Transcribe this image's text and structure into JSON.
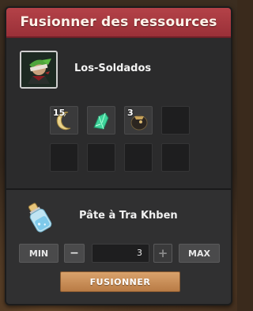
{
  "window": {
    "title": "Fusionner des ressources",
    "colors": {
      "titlebar": "#b44248",
      "panel": "#2a2a2b",
      "accent_button": "#c98c54"
    }
  },
  "player": {
    "name": "Los-Soldados",
    "portrait_icon": "character-portrait-icon"
  },
  "inventory_slots": [
    {
      "quantity": "15",
      "icon": "crescent-moon-resource-icon"
    },
    {
      "quantity": "",
      "icon": "green-crystal-resource-icon"
    },
    {
      "quantity": "3",
      "icon": "dark-pouch-resource-icon"
    },
    {
      "quantity": "",
      "icon": ""
    },
    {
      "quantity": "",
      "icon": ""
    },
    {
      "quantity": "",
      "icon": ""
    },
    {
      "quantity": "",
      "icon": ""
    },
    {
      "quantity": "",
      "icon": ""
    }
  ],
  "result": {
    "name": "Pâte à Tra Khben",
    "icon": "potion-bottle-icon"
  },
  "controls": {
    "min_label": "MIN",
    "minus_label": "−",
    "quantity_value": "3",
    "plus_label": "+",
    "max_label": "MAX",
    "fuse_label": "FUSIONNER"
  }
}
